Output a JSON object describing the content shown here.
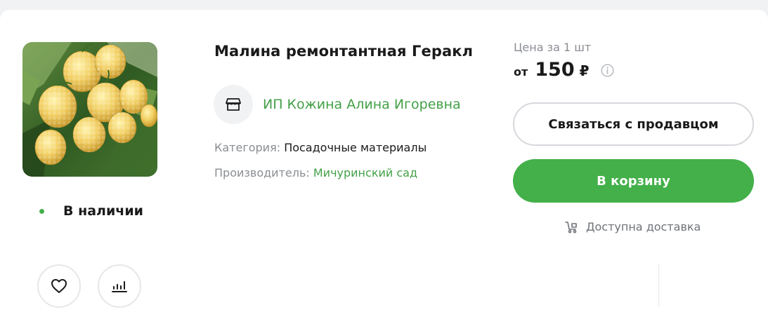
{
  "product": {
    "title": "Малина ремонтантная Геракл",
    "image_alt": "Малина ремонтантная Геракл",
    "availability": "В наличии"
  },
  "seller": {
    "name": "ИП Кожина Алина Игоревна",
    "icon": "store-icon"
  },
  "details": {
    "category_label": "Категория:",
    "category_value": "Посадочные материалы",
    "maker_label": "Производитель:",
    "maker_value": "Мичуринский сад"
  },
  "price": {
    "caption": "Цена за 1 шт",
    "from": "от",
    "value": "150",
    "currency": "₽"
  },
  "actions": {
    "contact_label": "Связаться с продавцом",
    "cart_label": "В корзину",
    "delivery_label": "Доступна доставка"
  },
  "colors": {
    "accent_green": "#43b049",
    "link_green": "#43a047",
    "muted_text": "#8a8d93"
  }
}
